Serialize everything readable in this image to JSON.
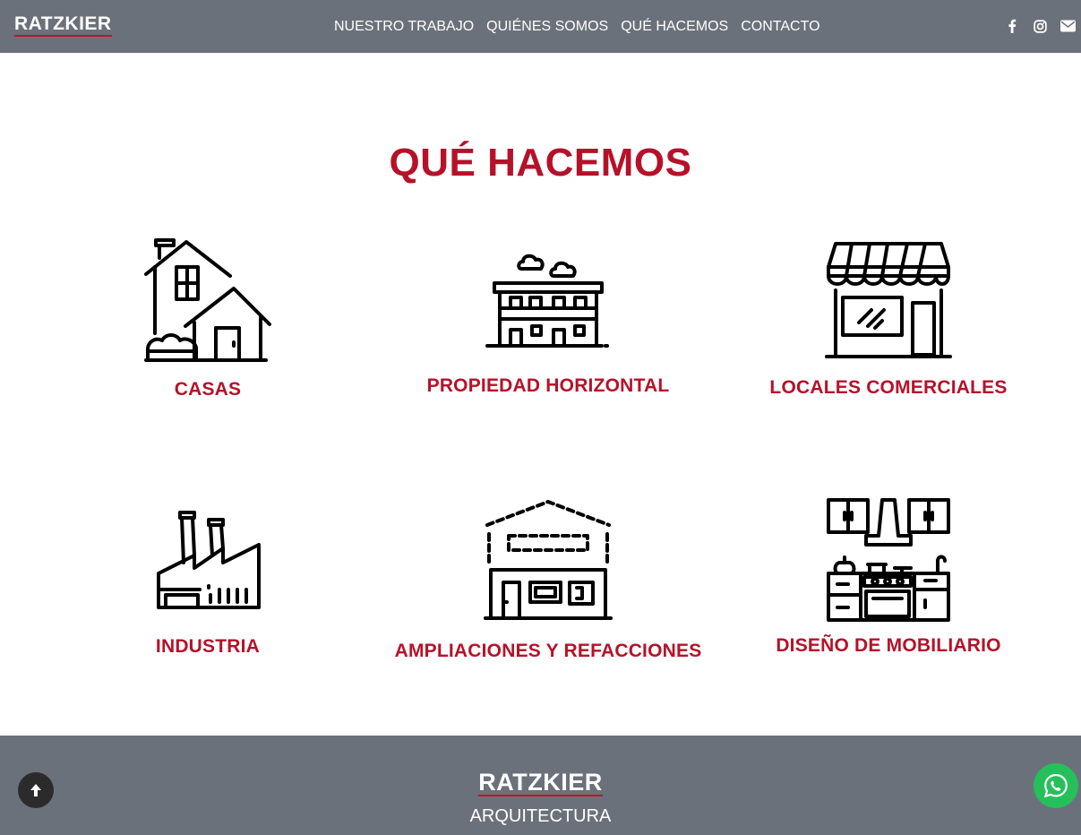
{
  "header": {
    "logo": "RATZKIER",
    "nav": [
      "NUESTRO TRABAJO",
      "QUIÉNES SOMOS",
      "QUÉ HACEMOS",
      "CONTACTO"
    ],
    "social_icons": [
      "facebook-icon",
      "instagram-icon",
      "envelope-icon"
    ]
  },
  "section": {
    "title": "QUÉ HACEMOS",
    "services": [
      {
        "label": "CASAS",
        "icon": "house-icon"
      },
      {
        "label": "PROPIEDAD HORIZONTAL",
        "icon": "apartment-building-icon"
      },
      {
        "label": "LOCALES COMERCIALES",
        "icon": "storefront-icon"
      },
      {
        "label": "INDUSTRIA",
        "icon": "factory-icon"
      },
      {
        "label": "AMPLIACIONES Y REFACCIONES",
        "icon": "extension-building-icon"
      },
      {
        "label": "DISEÑO DE MOBILIARIO",
        "icon": "kitchen-furniture-icon"
      }
    ]
  },
  "footer": {
    "logo": "RATZKIER",
    "subtitle": "ARQUITECTURA"
  },
  "floating": {
    "scroll_top_icon": "arrow-up-icon",
    "whatsapp_icon": "whatsapp-icon"
  },
  "colors": {
    "accent": "#b5122a",
    "bar": "#6b717a",
    "whatsapp": "#25c05a"
  }
}
